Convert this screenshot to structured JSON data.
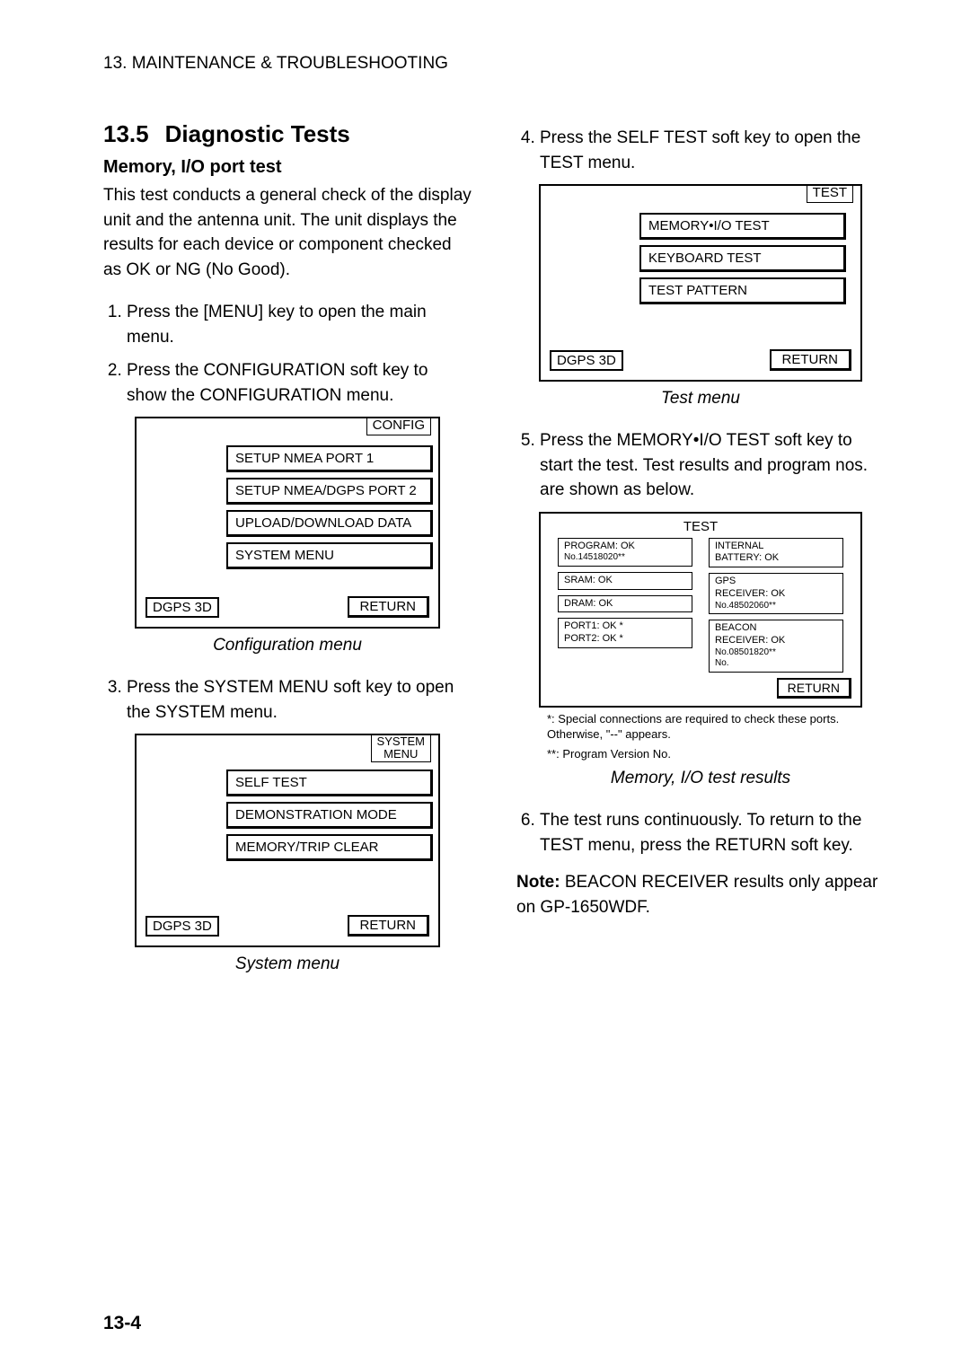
{
  "header": "13. MAINTENANCE & TROUBLESHOOTING",
  "section": {
    "number": "13.5",
    "title": "Diagnostic Tests"
  },
  "sub1": "Memory, I/O port test",
  "intro": "This test conducts a general check of the display unit and the antenna unit. The unit displays the results for each device or component checked as OK or NG (No Good).",
  "steps": {
    "s1": "Press the [MENU] key to open the main menu.",
    "s2": "Press the CONFIGURATION soft key to show the CONFIGURATION menu.",
    "s3": "Press the SYSTEM MENU soft key to open the SYSTEM menu.",
    "s4": "Press the SELF TEST soft key to open the TEST menu.",
    "s5": "Press the MEMORY•I/O TEST soft key to start the test. Test results and program nos. are shown as below.",
    "s6": "The test runs continuously. To return to the TEST menu, press the RETURN soft key."
  },
  "captions": {
    "config": "Configuration menu",
    "system": "System menu",
    "test": "Test menu",
    "results": "Memory, I/O test results"
  },
  "common": {
    "dgps": "DGPS 3D",
    "return": "RETURN"
  },
  "config_menu": {
    "label": "CONFIG",
    "items": [
      "SETUP NMEA PORT 1",
      "SETUP NMEA/DGPS PORT 2",
      "UPLOAD/DOWNLOAD DATA",
      "SYSTEM MENU"
    ]
  },
  "system_menu": {
    "label1": "SYSTEM",
    "label2": "MENU",
    "items": [
      "SELF TEST",
      "DEMONSTRATION MODE",
      "MEMORY/TRIP CLEAR"
    ]
  },
  "test_menu": {
    "label": "TEST",
    "items": [
      "MEMORY•I/O TEST",
      "KEYBOARD TEST",
      "TEST PATTERN"
    ]
  },
  "results_diag": {
    "title": "TEST",
    "left": [
      {
        "l1": "PROGRAM: OK",
        "l2": "No.14518020**"
      },
      {
        "l1": "SRAM: OK"
      },
      {
        "l1": "DRAM: OK"
      },
      {
        "l1": "PORT1: OK *",
        "l2": "PORT2: OK *"
      }
    ],
    "right": [
      {
        "l1": "INTERNAL",
        "l2": "BATTERY: OK"
      },
      {
        "l1": "GPS",
        "l2": "RECEIVER: OK",
        "l3": "No.48502060**"
      },
      {
        "l1": "BEACON",
        "l2": "RECEIVER: OK",
        "l3": "No.08501820**",
        "l4": "No."
      }
    ],
    "return": "RETURN"
  },
  "footnotes": {
    "n1": "*: Special connections are required to check these ports. Otherwise, \"--\" appears.",
    "n2": "**: Program Version No."
  },
  "note": {
    "lead": "Note:",
    "body": " BEACON RECEIVER results only appear on GP-1650WDF."
  },
  "page": "13-4"
}
